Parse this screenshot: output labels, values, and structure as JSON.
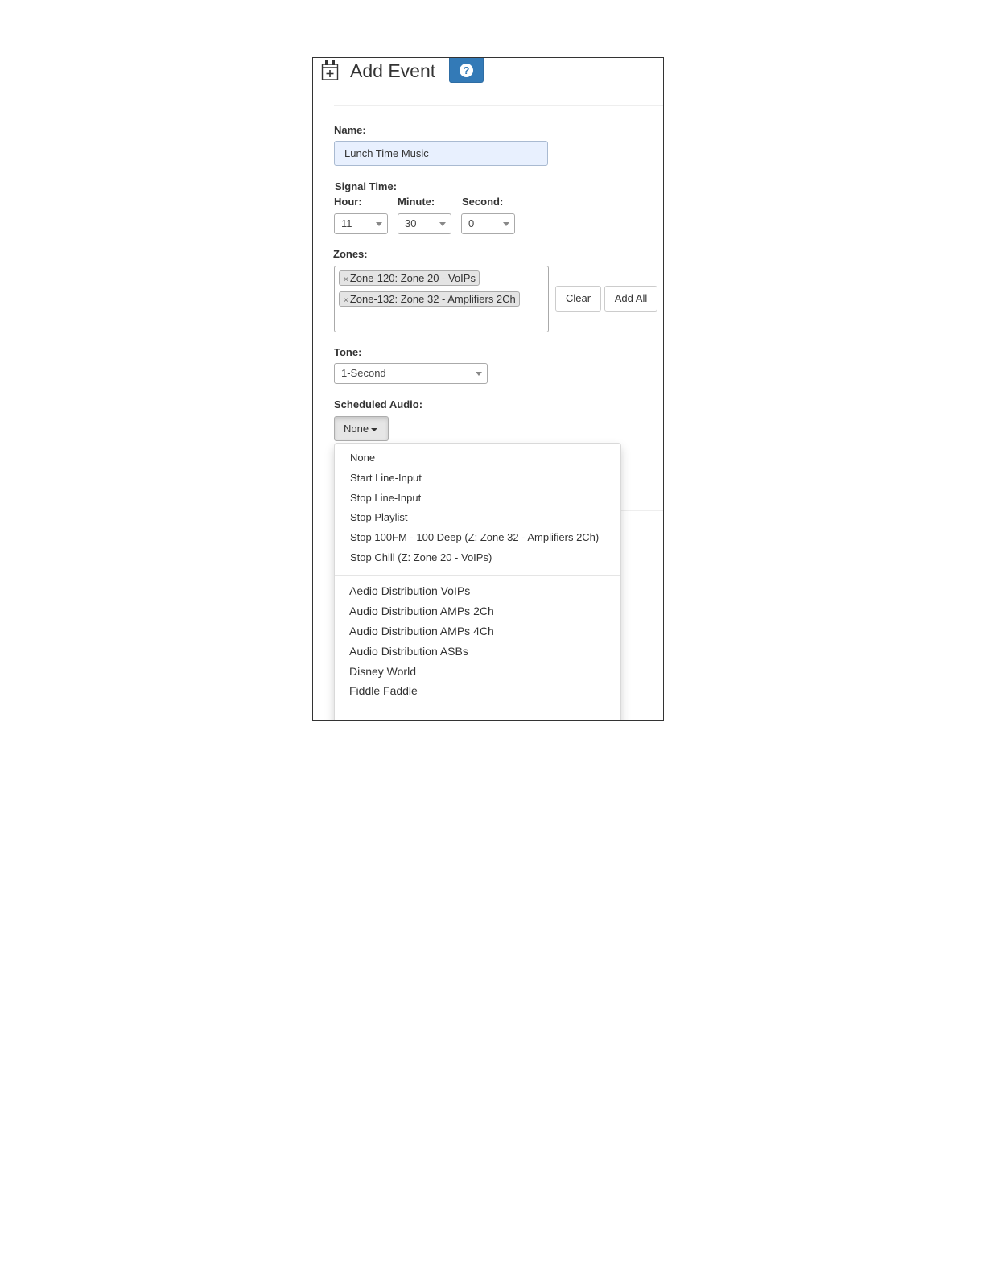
{
  "header": {
    "title": "Add Event",
    "calendar_icon": "calendar-plus-icon",
    "help_icon": "question-circle-icon",
    "help_glyph": "?"
  },
  "form": {
    "name_label": "Name:",
    "name_value": "Lunch Time Music",
    "signal_time_label": "Signal Time:",
    "hour_label": "Hour:",
    "hour_value": "11",
    "minute_label": "Minute:",
    "minute_value": "30",
    "second_label": "Second:",
    "second_value": "0",
    "zones_label": "Zones:",
    "zones": [
      {
        "remove": "×",
        "label": "Zone-120: Zone 20 - VoIPs"
      },
      {
        "remove": "×",
        "label": "Zone-132: Zone 32 - Amplifiers 2Ch"
      }
    ],
    "clear_label": "Clear",
    "add_all_label": "Add All",
    "tone_label": "Tone:",
    "tone_value": "1-Second",
    "scheduled_audio_label": "Scheduled Audio:",
    "scheduled_audio_value": "None"
  },
  "dropdown": {
    "group1": [
      "None",
      "Start Line-Input",
      "Stop Line-Input",
      "Stop Playlist",
      "Stop 100FM - 100 Deep (Z: Zone 32 - Amplifiers 2Ch)",
      "Stop Chill (Z: Zone 20 - VoIPs)"
    ],
    "group2": [
      "Aedio Distribution VoIPs",
      "Audio Distribution AMPs 2Ch",
      "Audio Distribution AMPs 4Ch",
      "Audio Distribution ASBs",
      "Disney World",
      "Fiddle Faddle"
    ]
  },
  "colors": {
    "accent": "#337ab7",
    "input_autofill": "#e8f0fe",
    "chip": "#e4e4e4"
  }
}
